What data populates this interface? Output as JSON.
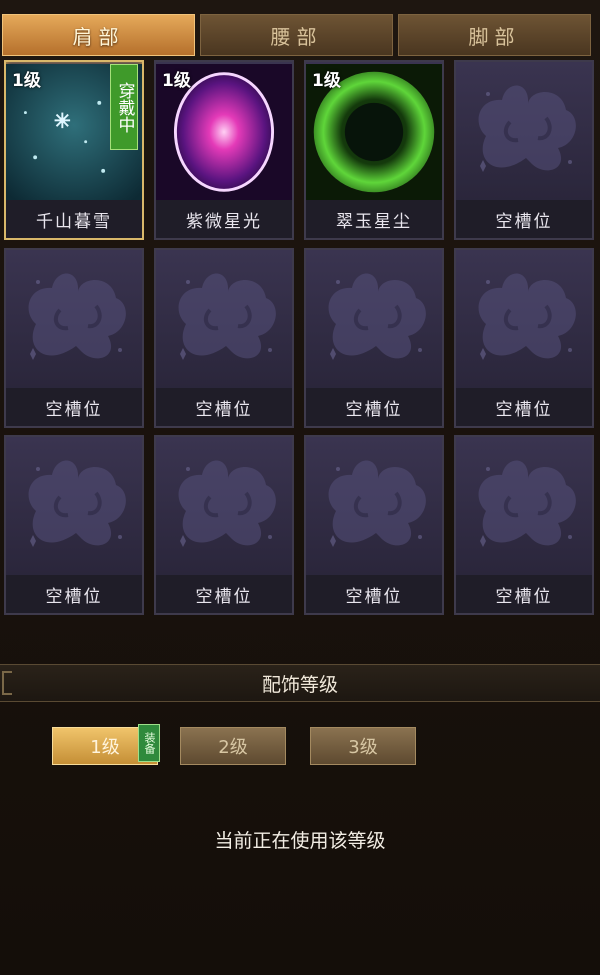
{
  "tabs": [
    {
      "label": "肩部",
      "active": true
    },
    {
      "label": "腰部",
      "active": false
    },
    {
      "label": "脚部",
      "active": false
    }
  ],
  "slots": [
    {
      "level": "1级",
      "name": "千山暮雪",
      "wearing": "穿戴中",
      "effect": "snow",
      "selected": true
    },
    {
      "level": "1级",
      "name": "紫微星光",
      "effect": "purple-orb"
    },
    {
      "level": "1级",
      "name": "翠玉星尘",
      "effect": "green-burst"
    },
    {
      "name": "空槽位",
      "effect": "empty"
    },
    {
      "name": "空槽位",
      "effect": "empty"
    },
    {
      "name": "空槽位",
      "effect": "empty"
    },
    {
      "name": "空槽位",
      "effect": "empty"
    },
    {
      "name": "空槽位",
      "effect": "empty"
    },
    {
      "name": "空槽位",
      "effect": "empty"
    },
    {
      "name": "空槽位",
      "effect": "empty"
    },
    {
      "name": "空槽位",
      "effect": "empty"
    },
    {
      "name": "空槽位",
      "effect": "empty"
    }
  ],
  "section": {
    "title": "配饰等级"
  },
  "levels": [
    {
      "label": "1级",
      "active": true
    },
    {
      "label": "2级",
      "active": false
    },
    {
      "label": "3级",
      "active": false
    }
  ],
  "equip_tag": "装备",
  "status_text": "当前正在使用该等级",
  "colors": {
    "accent": "#e5a95a",
    "equip_green": "#3f9a2a",
    "slot_bg": "#2e2a40"
  }
}
